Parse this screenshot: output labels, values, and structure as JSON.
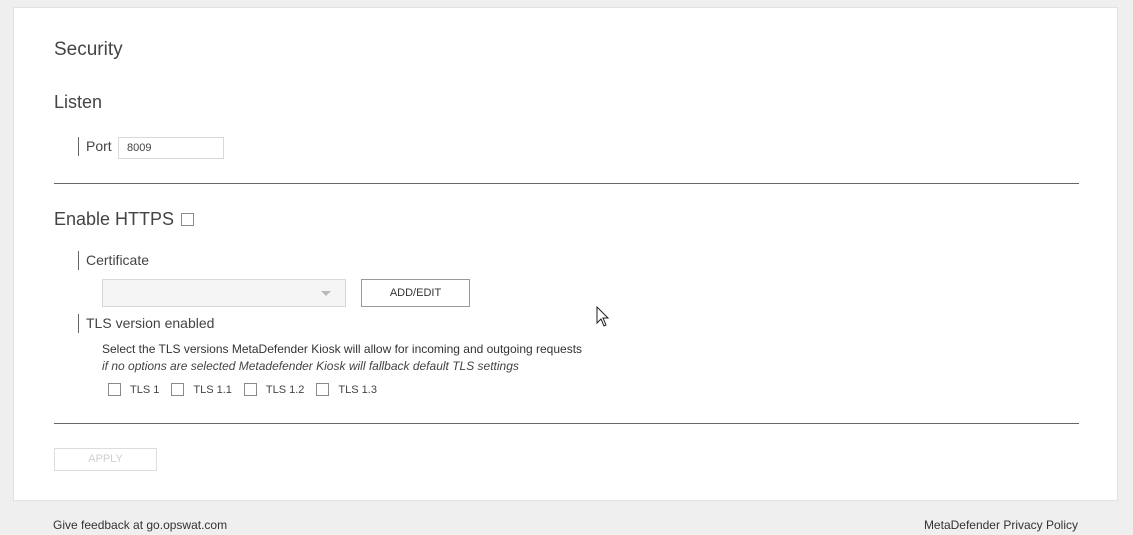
{
  "page": {
    "title": "Security"
  },
  "listen": {
    "title": "Listen",
    "port_label": "Port",
    "port_value": "8009"
  },
  "https": {
    "title": "Enable HTTPS",
    "enabled": false,
    "certificate_label": "Certificate",
    "certificate_value": "",
    "add_edit_label": "ADD/EDIT",
    "tls_label": "TLS version enabled",
    "tls_description": "Select the TLS versions MetaDefender Kiosk will allow for incoming and outgoing requests",
    "tls_hint": "if no options are selected Metadefender Kiosk will fallback default TLS settings",
    "tls_options": [
      {
        "label": "TLS 1",
        "checked": false
      },
      {
        "label": "TLS 1.1",
        "checked": false
      },
      {
        "label": "TLS 1.2",
        "checked": false
      },
      {
        "label": "TLS 1.3",
        "checked": false
      }
    ]
  },
  "actions": {
    "apply_label": "APPLY",
    "apply_enabled": false
  },
  "footer": {
    "feedback": "Give feedback at go.opswat.com",
    "privacy": "MetaDefender Privacy Policy"
  }
}
